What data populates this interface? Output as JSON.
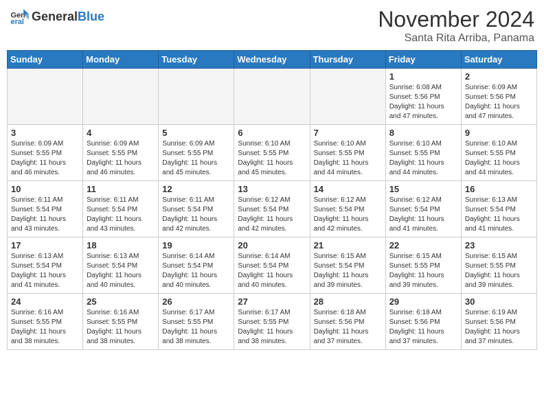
{
  "header": {
    "logo_general": "General",
    "logo_blue": "Blue",
    "title": "November 2024",
    "subtitle": "Santa Rita Arriba, Panama"
  },
  "days_of_week": [
    "Sunday",
    "Monday",
    "Tuesday",
    "Wednesday",
    "Thursday",
    "Friday",
    "Saturday"
  ],
  "weeks": [
    [
      {
        "day": "",
        "info": ""
      },
      {
        "day": "",
        "info": ""
      },
      {
        "day": "",
        "info": ""
      },
      {
        "day": "",
        "info": ""
      },
      {
        "day": "",
        "info": ""
      },
      {
        "day": "1",
        "info": "Sunrise: 6:08 AM\nSunset: 5:56 PM\nDaylight: 11 hours\nand 47 minutes."
      },
      {
        "day": "2",
        "info": "Sunrise: 6:09 AM\nSunset: 5:56 PM\nDaylight: 11 hours\nand 47 minutes."
      }
    ],
    [
      {
        "day": "3",
        "info": "Sunrise: 6:09 AM\nSunset: 5:55 PM\nDaylight: 11 hours\nand 46 minutes."
      },
      {
        "day": "4",
        "info": "Sunrise: 6:09 AM\nSunset: 5:55 PM\nDaylight: 11 hours\nand 46 minutes."
      },
      {
        "day": "5",
        "info": "Sunrise: 6:09 AM\nSunset: 5:55 PM\nDaylight: 11 hours\nand 45 minutes."
      },
      {
        "day": "6",
        "info": "Sunrise: 6:10 AM\nSunset: 5:55 PM\nDaylight: 11 hours\nand 45 minutes."
      },
      {
        "day": "7",
        "info": "Sunrise: 6:10 AM\nSunset: 5:55 PM\nDaylight: 11 hours\nand 44 minutes."
      },
      {
        "day": "8",
        "info": "Sunrise: 6:10 AM\nSunset: 5:55 PM\nDaylight: 11 hours\nand 44 minutes."
      },
      {
        "day": "9",
        "info": "Sunrise: 6:10 AM\nSunset: 5:55 PM\nDaylight: 11 hours\nand 44 minutes."
      }
    ],
    [
      {
        "day": "10",
        "info": "Sunrise: 6:11 AM\nSunset: 5:54 PM\nDaylight: 11 hours\nand 43 minutes."
      },
      {
        "day": "11",
        "info": "Sunrise: 6:11 AM\nSunset: 5:54 PM\nDaylight: 11 hours\nand 43 minutes."
      },
      {
        "day": "12",
        "info": "Sunrise: 6:11 AM\nSunset: 5:54 PM\nDaylight: 11 hours\nand 42 minutes."
      },
      {
        "day": "13",
        "info": "Sunrise: 6:12 AM\nSunset: 5:54 PM\nDaylight: 11 hours\nand 42 minutes."
      },
      {
        "day": "14",
        "info": "Sunrise: 6:12 AM\nSunset: 5:54 PM\nDaylight: 11 hours\nand 42 minutes."
      },
      {
        "day": "15",
        "info": "Sunrise: 6:12 AM\nSunset: 5:54 PM\nDaylight: 11 hours\nand 41 minutes."
      },
      {
        "day": "16",
        "info": "Sunrise: 6:13 AM\nSunset: 5:54 PM\nDaylight: 11 hours\nand 41 minutes."
      }
    ],
    [
      {
        "day": "17",
        "info": "Sunrise: 6:13 AM\nSunset: 5:54 PM\nDaylight: 11 hours\nand 41 minutes."
      },
      {
        "day": "18",
        "info": "Sunrise: 6:13 AM\nSunset: 5:54 PM\nDaylight: 11 hours\nand 40 minutes."
      },
      {
        "day": "19",
        "info": "Sunrise: 6:14 AM\nSunset: 5:54 PM\nDaylight: 11 hours\nand 40 minutes."
      },
      {
        "day": "20",
        "info": "Sunrise: 6:14 AM\nSunset: 5:54 PM\nDaylight: 11 hours\nand 40 minutes."
      },
      {
        "day": "21",
        "info": "Sunrise: 6:15 AM\nSunset: 5:54 PM\nDaylight: 11 hours\nand 39 minutes."
      },
      {
        "day": "22",
        "info": "Sunrise: 6:15 AM\nSunset: 5:55 PM\nDaylight: 11 hours\nand 39 minutes."
      },
      {
        "day": "23",
        "info": "Sunrise: 6:15 AM\nSunset: 5:55 PM\nDaylight: 11 hours\nand 39 minutes."
      }
    ],
    [
      {
        "day": "24",
        "info": "Sunrise: 6:16 AM\nSunset: 5:55 PM\nDaylight: 11 hours\nand 38 minutes."
      },
      {
        "day": "25",
        "info": "Sunrise: 6:16 AM\nSunset: 5:55 PM\nDaylight: 11 hours\nand 38 minutes."
      },
      {
        "day": "26",
        "info": "Sunrise: 6:17 AM\nSunset: 5:55 PM\nDaylight: 11 hours\nand 38 minutes."
      },
      {
        "day": "27",
        "info": "Sunrise: 6:17 AM\nSunset: 5:55 PM\nDaylight: 11 hours\nand 38 minutes."
      },
      {
        "day": "28",
        "info": "Sunrise: 6:18 AM\nSunset: 5:56 PM\nDaylight: 11 hours\nand 37 minutes."
      },
      {
        "day": "29",
        "info": "Sunrise: 6:18 AM\nSunset: 5:56 PM\nDaylight: 11 hours\nand 37 minutes."
      },
      {
        "day": "30",
        "info": "Sunrise: 6:19 AM\nSunset: 5:56 PM\nDaylight: 11 hours\nand 37 minutes."
      }
    ]
  ]
}
